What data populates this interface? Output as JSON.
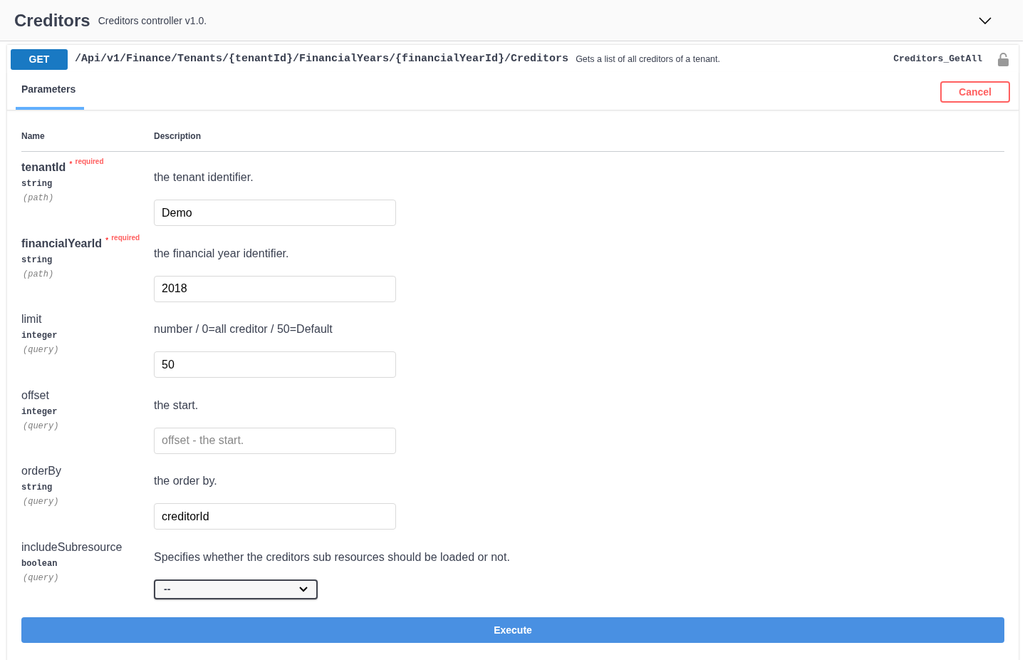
{
  "section": {
    "title": "Creditors",
    "description": "Creditors controller v1.0.",
    "expanded": true
  },
  "operation": {
    "method": "GET",
    "path": "/Api/v1/Finance/Tenants/{tenantId}/FinancialYears/{financialYearId}/Creditors",
    "summary": "Gets a list of all creditors of a tenant.",
    "operation_id": "Creditors_GetAll"
  },
  "tabs": [
    {
      "label": "Parameters",
      "selected": true
    }
  ],
  "cancel_button": "Cancel",
  "table": {
    "columns": [
      "Name",
      "Description"
    ],
    "rows": [
      {
        "name": "tenantId",
        "required": {
          "star": "*",
          "label": "required"
        },
        "type": "string",
        "location": "(path)",
        "description": "the tenant identifier.",
        "field": {
          "kind": "input",
          "value": "Demo"
        }
      },
      {
        "name": "financialYearId",
        "required": {
          "star": "*",
          "label": "required"
        },
        "type": "string",
        "location": "(path)",
        "description": "the financial year identifier.",
        "field": {
          "kind": "input",
          "value": "2018"
        }
      },
      {
        "name": "limit",
        "type": "integer",
        "location": "(query)",
        "description": "number / 0=all creditor / 50=Default",
        "field": {
          "kind": "input",
          "value": "50"
        }
      },
      {
        "name": "offset",
        "type": "integer",
        "location": "(query)",
        "description": "the start.",
        "field": {
          "kind": "input",
          "placeholder": "offset - the start."
        }
      },
      {
        "name": "orderBy",
        "type": "string",
        "location": "(query)",
        "description": "the order by.",
        "field": {
          "kind": "input",
          "value": "creditorId"
        }
      },
      {
        "name": "includeSubresource",
        "type": "boolean",
        "location": "(query)",
        "description": "Specifies whether the creditors sub resources should be loaded or not.",
        "field": {
          "kind": "select",
          "value": "--"
        }
      }
    ]
  },
  "execute_button": "Execute"
}
